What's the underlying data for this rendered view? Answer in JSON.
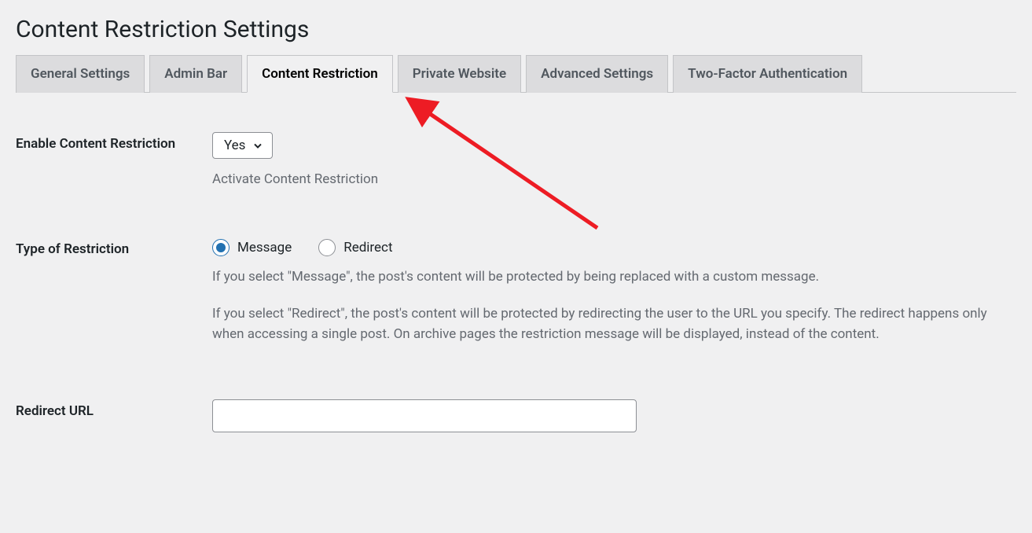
{
  "page": {
    "title": "Content Restriction Settings"
  },
  "tabs": [
    {
      "label": "General Settings",
      "active": false
    },
    {
      "label": "Admin Bar",
      "active": false
    },
    {
      "label": "Content Restriction",
      "active": true
    },
    {
      "label": "Private Website",
      "active": false
    },
    {
      "label": "Advanced Settings",
      "active": false
    },
    {
      "label": "Two-Factor Authentication",
      "active": false
    }
  ],
  "fields": {
    "enable": {
      "label": "Enable Content Restriction",
      "value": "Yes",
      "description": "Activate Content Restriction"
    },
    "type": {
      "label": "Type of Restriction",
      "options": {
        "message": "Message",
        "redirect": "Redirect"
      },
      "selected": "message",
      "description1": "If you select \"Message\", the post's content will be protected by being replaced with a custom message.",
      "description2": "If you select \"Redirect\", the post's content will be protected by redirecting the user to the URL you specify. The redirect happens only when accessing a single post. On archive pages the restriction message will be displayed, instead of the content."
    },
    "redirect_url": {
      "label": "Redirect URL",
      "value": ""
    }
  },
  "annotation": {
    "arrow_color": "#ed1c24"
  }
}
